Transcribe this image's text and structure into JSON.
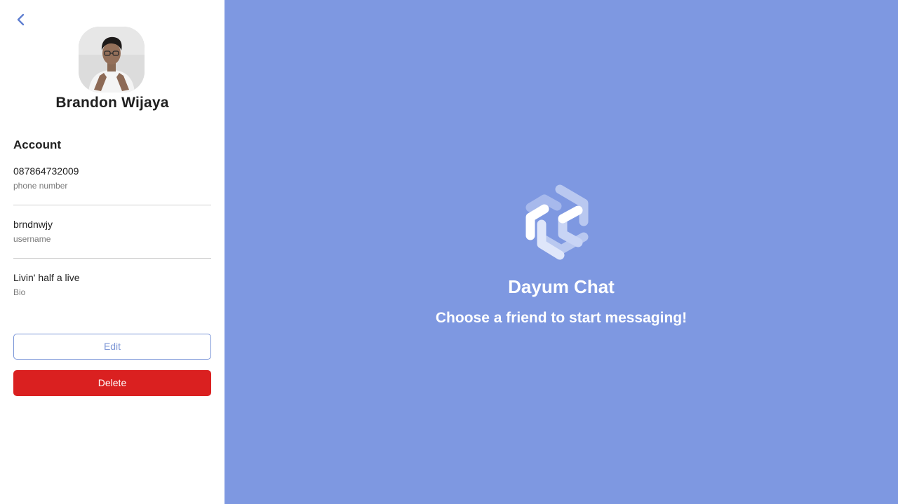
{
  "profile": {
    "name": "Brandon Wijaya",
    "avatar_alt": "Brandon Wijaya"
  },
  "account": {
    "title": "Account",
    "items": [
      {
        "value": "087864732009",
        "caption": "phone number"
      },
      {
        "value": "brndnwjy",
        "caption": "username"
      },
      {
        "value": "Livin' half a live",
        "caption": "Bio"
      }
    ]
  },
  "actions": {
    "edit_label": "Edit",
    "delete_label": "Delete"
  },
  "main": {
    "brand_title": "Dayum Chat",
    "subtitle": "Choose a friend to start messaging!"
  },
  "icons": {
    "back": "chevron-left-icon",
    "logo": "hexagon-swirl-logo-icon"
  },
  "colors": {
    "accent": "#7e98e1",
    "accent_text": "#7e97d6",
    "danger": "#da2020",
    "back_icon": "#5f7fd1"
  }
}
